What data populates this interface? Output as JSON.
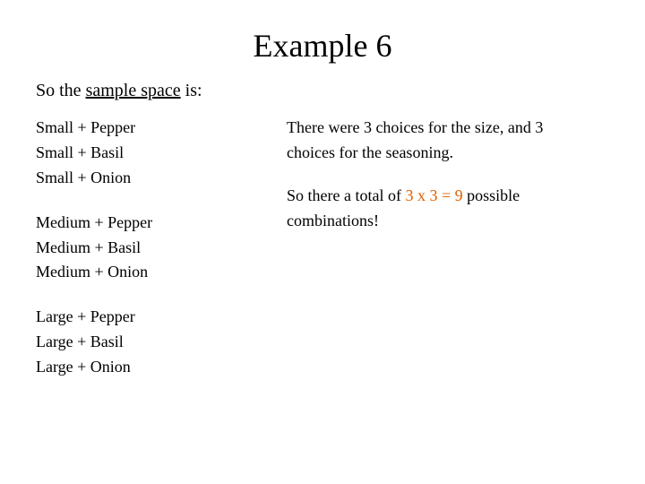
{
  "title": "Example 6",
  "subtitle": {
    "before": "So the ",
    "underline": "sample space",
    "after": " is:"
  },
  "left_column": {
    "groups": [
      {
        "id": "small-group",
        "items": [
          "Small + Pepper",
          "Small + Basil",
          "Small + Onion"
        ]
      },
      {
        "id": "medium-group",
        "items": [
          "Medium + Pepper",
          "Medium + Basil",
          "Medium + Onion"
        ]
      },
      {
        "id": "large-group",
        "items": [
          "Large + Pepper",
          "Large + Basil",
          "Large + Onion"
        ]
      }
    ]
  },
  "right_column": {
    "explanation1": {
      "text": "There were 3 choices for the size, and 3 choices for the seasoning."
    },
    "explanation2": {
      "before": "So there a total of ",
      "highlight": "3 x 3 = 9",
      "after": " possible combinations!"
    }
  }
}
